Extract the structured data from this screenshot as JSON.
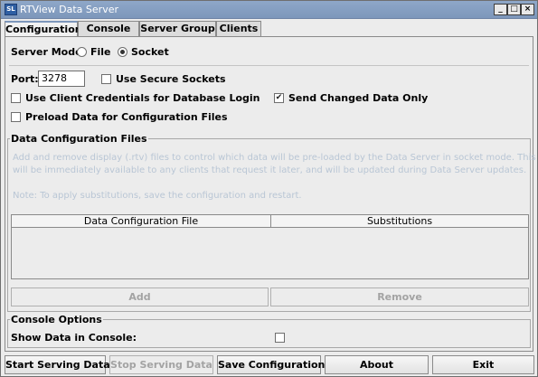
{
  "window": {
    "title": "RTView Data Server",
    "icon_text": "SL",
    "controls": {
      "minimize": "_",
      "maximize": "□",
      "close": "×"
    }
  },
  "tabs": [
    {
      "label": "Configuration",
      "active": true
    },
    {
      "label": "Console",
      "active": false
    },
    {
      "label": "Server Group",
      "active": false
    },
    {
      "label": "Clients",
      "active": false
    }
  ],
  "config": {
    "server_mode_label": "Server Mode:",
    "mode_file_label": "File",
    "mode_socket_label": "Socket",
    "mode_selected": "Socket",
    "port_label": "Port:",
    "port_value": "3278",
    "use_secure_sockets_label": "Use Secure Sockets",
    "use_secure_sockets_checked": false,
    "client_credentials_label": "Use Client Credentials for Database Login",
    "client_credentials_checked": false,
    "send_changed_label": "Send Changed Data Only",
    "send_changed_checked": true,
    "preload_label": "Preload Data for Configuration Files",
    "preload_checked": false
  },
  "data_config_files": {
    "title": "Data Configuration Files",
    "description_line1": "Add and remove display (.rtv) files to control which data will be pre-loaded by the Data Server in socket mode. This data",
    "description_line2": "will be immediately available to any clients that request it later, and will be updated during Data Server updates.",
    "note": "Note: To apply substitutions, save the configuration and restart.",
    "columns": [
      "Data Configuration File",
      "Substitutions"
    ],
    "rows": [],
    "add_label": "Add",
    "remove_label": "Remove"
  },
  "console_options": {
    "title": "Console Options",
    "show_data_label": "Show Data in Console:",
    "show_data_checked": false
  },
  "bottom_buttons": {
    "start": "Start Serving Data",
    "stop": "Stop Serving Data",
    "save": "Save Configuration",
    "about": "About",
    "exit": "Exit"
  },
  "check_glyph": "✔"
}
